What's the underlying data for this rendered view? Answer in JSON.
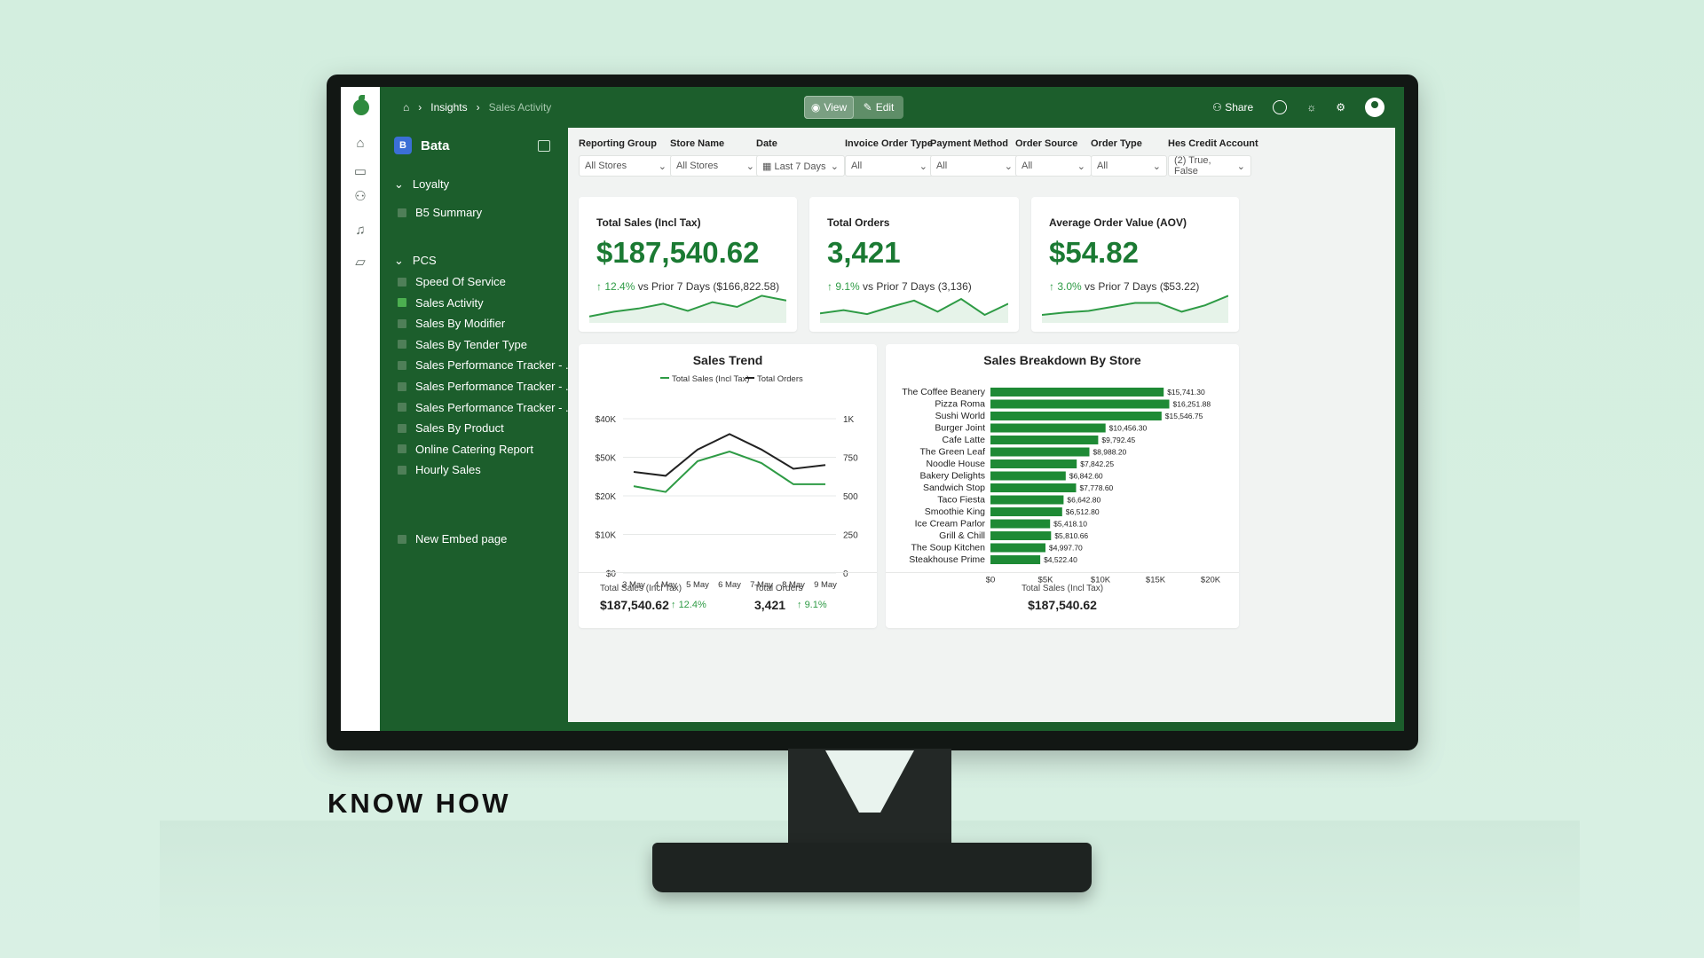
{
  "brand": "KNOW HOW",
  "breadcrumb": {
    "home_icon": "home-icon",
    "parent": "Insights",
    "current": "Sales Activity"
  },
  "mode_toggle": {
    "view_label": "View",
    "edit_label": "Edit"
  },
  "topbar": {
    "share_label": "Share"
  },
  "workspace": {
    "badge": "B",
    "name": "Bata"
  },
  "sidebar": {
    "section_loyalty": "Loyalty",
    "loyalty_items": [
      "B5 Summary"
    ],
    "section_pcs": "PCS",
    "pcs_items": [
      "Speed Of Service",
      "Sales Activity",
      "Sales By Modifier",
      "Sales By Tender Type",
      "Sales Performance Tracker - ...",
      "Sales Performance Tracker - ...",
      "Sales Performance Tracker - ...",
      "Sales By Product",
      "Online Catering Report",
      "Hourly Sales"
    ],
    "active_item": "Sales Activity",
    "extra_item": "New Embed page"
  },
  "filters": [
    {
      "label": "Reporting Group",
      "value": "All Stores"
    },
    {
      "label": "Store Name",
      "value": "All Stores"
    },
    {
      "label": "Date",
      "value": "Last 7 Days"
    },
    {
      "label": "Invoice Order Type",
      "value": "All"
    },
    {
      "label": "Payment Method",
      "value": "All"
    },
    {
      "label": "Order Source",
      "value": "All"
    },
    {
      "label": "Order Type",
      "value": "All"
    },
    {
      "label": "Hes Credit Account",
      "value": "(2) True, False"
    }
  ],
  "kpis": [
    {
      "title": "Total Sales (Incl Tax)",
      "value": "$187,540.62",
      "delta": "12.4%",
      "compare": "vs Prior 7 Days ($166,822.58)",
      "spark": [
        8,
        14,
        18,
        24,
        15,
        26,
        20,
        34,
        28
      ]
    },
    {
      "title": "Total Orders",
      "value": "3,421",
      "delta": "9.1%",
      "compare": "vs Prior 7 Days (3,136)",
      "spark": [
        12,
        16,
        11,
        20,
        28,
        14,
        30,
        10,
        24
      ]
    },
    {
      "title": "Average Order Value (AOV)",
      "value": "$54.82",
      "delta": "3.0%",
      "compare": "vs Prior 7 Days ($53.22)",
      "spark": [
        10,
        13,
        15,
        20,
        25,
        25,
        14,
        22,
        34
      ]
    }
  ],
  "chart_data": [
    {
      "type": "line",
      "title": "Sales Trend",
      "x": [
        "3 May",
        "4 May",
        "5 May",
        "6 May",
        "7 May",
        "8 May",
        "9 May"
      ],
      "series": [
        {
          "name": "Total Sales (Incl Tax)",
          "axis": "left",
          "color": "#2e9b45",
          "values": [
            22500,
            21000,
            29000,
            31500,
            28500,
            23000,
            23000
          ]
        },
        {
          "name": "Total Orders",
          "axis": "right",
          "color": "#222222",
          "values": [
            655,
            630,
            800,
            900,
            800,
            675,
            700
          ]
        }
      ],
      "yticks_left": [
        "$0",
        "$10K",
        "$20K",
        "$50K",
        "$40K"
      ],
      "yticks_right": [
        "0",
        "250",
        "500",
        "750",
        "1K"
      ],
      "ylim_right": [
        0,
        1000
      ],
      "grid": true,
      "legend": "top"
    },
    {
      "type": "bar",
      "orientation": "horizontal",
      "title": "Sales Breakdown By Store",
      "categories": [
        "The Coffee Beanery",
        "Pizza Roma",
        "Sushi World",
        "Burger Joint",
        "Cafe Latte",
        "The Green Leaf",
        "Noodle House",
        "Bakery Delights",
        "Sandwich Stop",
        "Taco Fiesta",
        "Smoothie King",
        "Ice Cream Parlor",
        "Grill & Chill",
        "The Soup Kitchen",
        "Steakhouse Prime"
      ],
      "values": [
        15741.3,
        16251.88,
        15546.75,
        10456.3,
        9792.45,
        8988.2,
        7842.25,
        6842.6,
        7778.6,
        6642.8,
        6512.8,
        5418.1,
        5510.66,
        4997.7,
        4522.4
      ],
      "labels": [
        "$15,741.30",
        "$16,251.88",
        "$15,546.75",
        "$10,456.30",
        "$9,792.45",
        "$8,988.20",
        "$7,842.25",
        "$6,842.60",
        "$7,778.60",
        "$6,642.80",
        "$6,512.80",
        "$5,418.10",
        "$5,810.66",
        "$4,997.70",
        "$4,522.40"
      ],
      "xticks": [
        "$0",
        "$5K",
        "$10K",
        "$15K",
        "$20K"
      ],
      "xlim": [
        0,
        20000
      ],
      "color": "#1e8a35"
    }
  ],
  "trend_footer": {
    "sales_title": "Total Sales (Incl Tax)",
    "sales_value": "$187,540.62",
    "sales_delta": "12.4%",
    "orders_title": "Total Orders",
    "orders_value": "3,421",
    "orders_delta": "9.1%"
  },
  "store_footer": {
    "title": "Total Sales (Incl Tax)",
    "value": "$187,540.62"
  },
  "colors": {
    "accent": "#1b7a33",
    "sidebar": "#1c5e2c",
    "positive": "#2e9b45"
  }
}
